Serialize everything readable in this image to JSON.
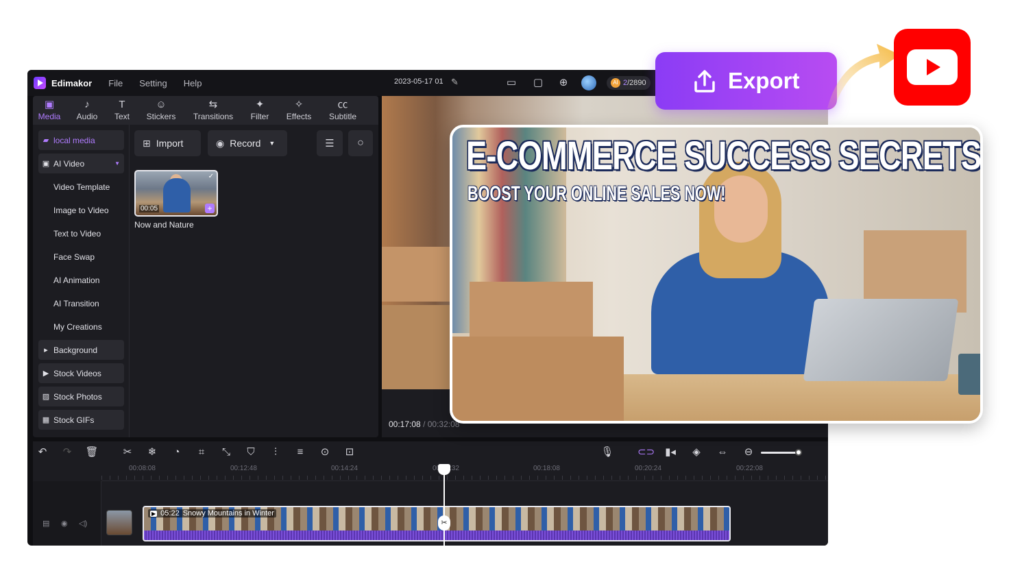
{
  "titlebar": {
    "app_name": "Edimakor",
    "menus": [
      "File",
      "Setting",
      "Help"
    ],
    "project_name": "2023-05-17 01",
    "credits_used": "2",
    "credits_total": "/2890",
    "credits_badge": "AI"
  },
  "tabs": [
    {
      "label": "Media",
      "icon": "media-icon",
      "active": true
    },
    {
      "label": "Audio",
      "icon": "music-note-icon"
    },
    {
      "label": "Text",
      "icon": "text-icon"
    },
    {
      "label": "Stickers",
      "icon": "sticker-icon"
    },
    {
      "label": "Transitions",
      "icon": "transition-icon"
    },
    {
      "label": "Filter",
      "icon": "filter-icon"
    },
    {
      "label": "Effects",
      "icon": "effects-icon"
    },
    {
      "label": "Subtitle",
      "icon": "subtitle-icon"
    }
  ],
  "sidebar": {
    "local_media": "local media",
    "ai_video": "AI Video",
    "sub_items": [
      "Video Template",
      "Image to Video",
      "Text to Video",
      "Face Swap",
      "AI Animation",
      "AI Transition",
      "My Creations"
    ],
    "background": "Background",
    "stock_videos": "Stock Videos",
    "stock_photos": "Stock Photos",
    "stock_gifs": "Stock GIFs"
  },
  "media": {
    "import_label": "Import",
    "record_label": "Record",
    "item_name": "Now and Nature",
    "item_duration": "00:05"
  },
  "preview": {
    "current_time": "00:17:08",
    "total_time": "/ 00:32:08"
  },
  "timeline": {
    "ticks": [
      "00:08:08",
      "00:12:48",
      "00:14:24",
      "00:16:32",
      "00:18:08",
      "00:20:24",
      "00:22:08"
    ],
    "clip_duration": "05:22",
    "clip_title": "Snowy Mountains in Winter"
  },
  "overlay": {
    "export_label": "Export",
    "thumbnail_title": "E-COMMERCE SUCCESS SECRETS",
    "thumbnail_subtitle": "BOOST YOUR ONLINE SALES NOW!"
  },
  "colors": {
    "accent": "#b07cff",
    "export_gradient_start": "#8b3cf5",
    "export_gradient_end": "#b84cf2",
    "youtube_red": "#ff0000"
  }
}
